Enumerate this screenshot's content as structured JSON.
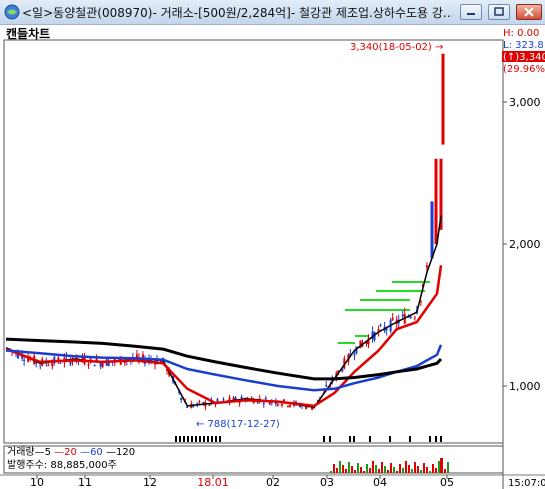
{
  "window": {
    "title": "<일>동양철관(008970)- 거래소-[500원/2,284억]- 철강관 제조업.상하수도용 강...",
    "btn_minimize": "minimize",
    "btn_restore": "restore",
    "btn_close": "close"
  },
  "chart": {
    "label": "캔들차트",
    "y_ticks": [
      "3,000",
      "2,000",
      "1,000"
    ],
    "x_ticks": [
      {
        "label": "10",
        "color": "#000000"
      },
      {
        "label": "11",
        "color": "#000000"
      },
      {
        "label": "12",
        "color": "#000000"
      },
      {
        "label": "18.01",
        "color": "#e00000"
      },
      {
        "label": "02",
        "color": "#000000"
      },
      {
        "label": "03",
        "color": "#000000"
      },
      {
        "label": "04",
        "color": "#000000"
      },
      {
        "label": "05",
        "color": "#000000"
      }
    ],
    "time": "15:07:0",
    "high_annotation": "3,340(18-05-02) →",
    "low_annotation": "← 788(17-12-27)",
    "info_lines": [
      "H: 0.00",
      "L: 323.8",
      "(↑)3,340",
      "(29.96%"
    ],
    "volume_legend": {
      "prefix": "거래량",
      "ma5": "5",
      "ma20": "20",
      "ma60": "60",
      "ma120": "120"
    },
    "shares": "발행주수:  88,885,000주",
    "colors": {
      "up": "#e00000",
      "down": "#1a3fd0",
      "ma5": "#000000",
      "ma20": "#e00000",
      "ma60": "#1a3fd0",
      "ma120": "#000000",
      "box": "#22dd22"
    }
  },
  "chart_data": {
    "type": "line",
    "title": "캔들차트",
    "ylim": [
      500,
      3500
    ],
    "x": [
      "2017-09-28",
      "2017-10-15",
      "2017-11-01",
      "2017-11-15",
      "2017-12-01",
      "2017-12-15",
      "2017-12-27",
      "2018-01-10",
      "2018-01-25",
      "2018-02-10",
      "2018-02-28",
      "2018-03-10",
      "2018-03-20",
      "2018-04-01",
      "2018-04-10",
      "2018-04-20",
      "2018-04-25",
      "2018-04-30",
      "2018-05-02"
    ],
    "series": [
      {
        "name": "5",
        "values": [
          1270,
          1160,
          1190,
          1165,
          1190,
          1180,
          860,
          880,
          910,
          890,
          850,
          1050,
          1250,
          1380,
          1450,
          1520,
          1800,
          2000,
          2200
        ]
      },
      {
        "name": "20",
        "values": [
          1260,
          1170,
          1180,
          1170,
          1180,
          1160,
          980,
          880,
          900,
          890,
          860,
          950,
          1100,
          1250,
          1400,
          1450,
          1550,
          1650,
          1850
        ]
      },
      {
        "name": "60",
        "values": [
          1250,
          1230,
          1210,
          1200,
          1195,
          1185,
          1120,
          1080,
          1040,
          1000,
          970,
          980,
          1020,
          1060,
          1100,
          1140,
          1180,
          1220,
          1290
        ]
      },
      {
        "name": "120",
        "values": [
          1330,
          1320,
          1310,
          1300,
          1280,
          1260,
          1210,
          1170,
          1130,
          1090,
          1050,
          1050,
          1060,
          1080,
          1100,
          1120,
          1140,
          1160,
          1190
        ]
      }
    ]
  }
}
